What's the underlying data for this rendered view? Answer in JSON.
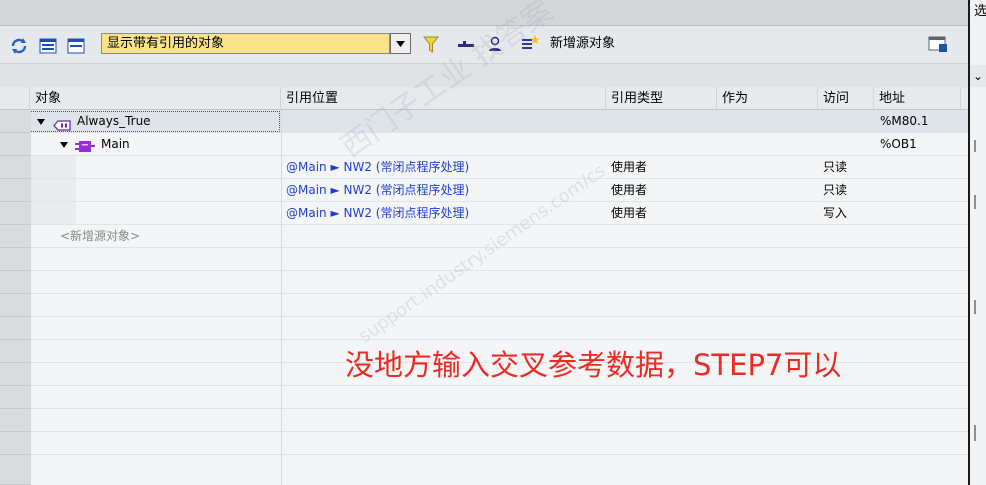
{
  "toolbar": {
    "filter_value": "显示带有引用的对象",
    "new_source_label": "新增源对象"
  },
  "columns": {
    "object": "对象",
    "ref_location": "引用位置",
    "ref_type": "引用类型",
    "as": "作为",
    "access": "访问",
    "address": "地址"
  },
  "rows": [
    {
      "object": "Always_True",
      "ref_location": "",
      "ref_type": "",
      "as": "",
      "access": "",
      "address": "%M80.1"
    },
    {
      "object": "Main",
      "ref_location": "",
      "ref_type": "",
      "as": "",
      "access": "",
      "address": "%OB1"
    },
    {
      "object": "",
      "ref_location": "@Main ► NW2 (常闭点程序处理)",
      "ref_type": "使用者",
      "as": "",
      "access": "只读",
      "address": ""
    },
    {
      "object": "",
      "ref_location": "@Main ► NW2 (常闭点程序处理)",
      "ref_type": "使用者",
      "as": "",
      "access": "只读",
      "address": ""
    },
    {
      "object": "",
      "ref_location": "@Main ► NW2 (常闭点程序处理)",
      "ref_type": "使用者",
      "as": "",
      "access": "写入",
      "address": ""
    }
  ],
  "new_source_placeholder": "<新增源对象>",
  "watermark": {
    "line1": "西门子工业 找答案",
    "line2": "support.industry.siemens.com/cs"
  },
  "annotation": "没地方输入交叉参考数据，STEP7可以",
  "right_panel": {
    "top_char": "选",
    "chevron": "⌄"
  }
}
